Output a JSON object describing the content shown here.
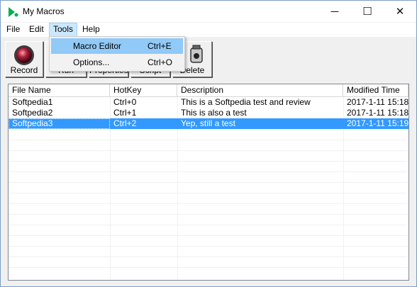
{
  "window": {
    "title": "My Macros",
    "icon": "green-play-icon",
    "controls": {
      "minimize": "─",
      "maximize": "☐",
      "close": "✕"
    }
  },
  "menubar": {
    "items": [
      {
        "label": "File"
      },
      {
        "label": "Edit"
      },
      {
        "label": "Tools"
      },
      {
        "label": "Help"
      }
    ]
  },
  "tools_menu": {
    "items": [
      {
        "label": "Macro Editor",
        "shortcut": "Ctrl+E"
      },
      {
        "label": "Options...",
        "shortcut": "Ctrl+O"
      }
    ]
  },
  "toolbar": {
    "buttons": [
      {
        "label": "Record",
        "icon": "record-icon"
      },
      {
        "label": "Run",
        "icon": "run-icon"
      },
      {
        "label": "Properties",
        "icon": "properties-icon"
      },
      {
        "label": "Script",
        "icon": "script-icon"
      },
      {
        "label": "Delete",
        "icon": "delete-icon"
      }
    ]
  },
  "list": {
    "columns": [
      "File Name",
      "HotKey",
      "Description",
      "Modified Time"
    ],
    "rows": [
      {
        "file": "Softpedia1",
        "hotkey": "Ctrl+0",
        "description": "This is a Softpedia test and review",
        "modified": "2017-1-11 15:18",
        "selected": false
      },
      {
        "file": "Softpedia2",
        "hotkey": "Ctrl+1",
        "description": "This is also a test",
        "modified": "2017-1-11 15:18",
        "selected": false
      },
      {
        "file": "Softpedia3",
        "hotkey": "Ctrl+2",
        "description": "Yep, still a test",
        "modified": "2017-1-11 15:19",
        "selected": true
      }
    ]
  },
  "colors": {
    "selection": "#3399ff",
    "menu_highlight": "#91c9f7",
    "app_icon": "#00b050"
  }
}
